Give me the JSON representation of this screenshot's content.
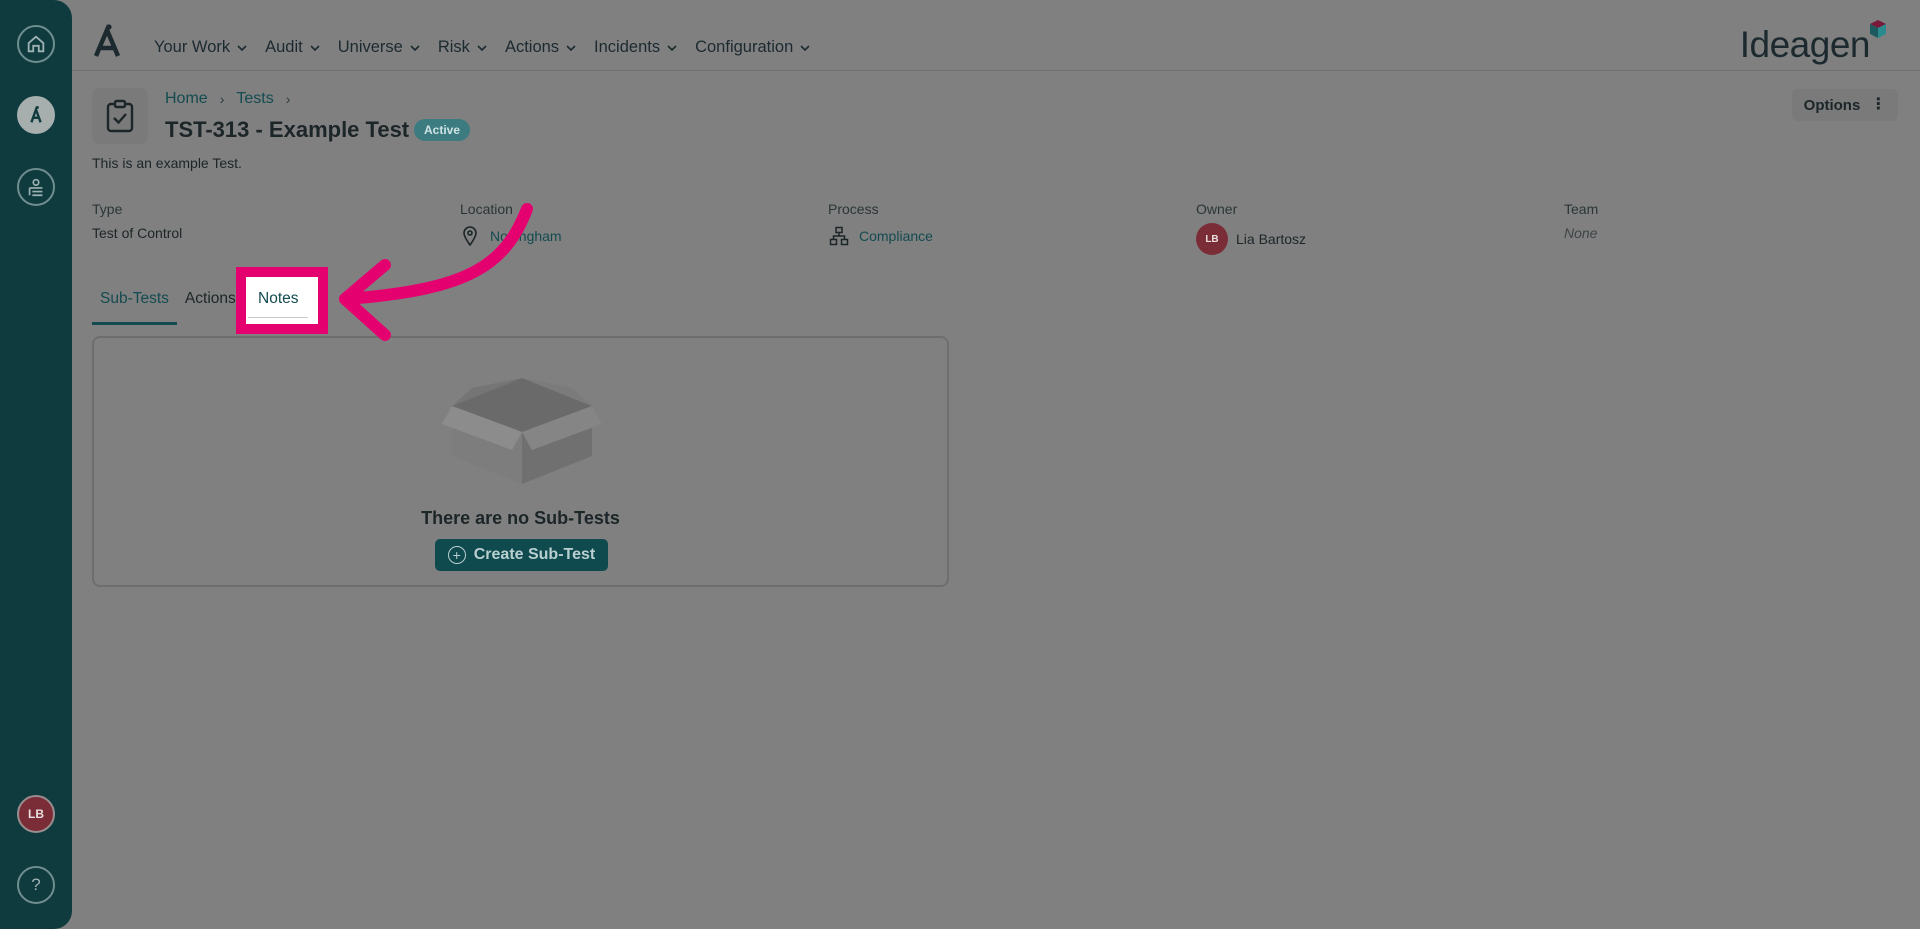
{
  "sidebar": {
    "items": [
      {
        "icon": "home-icon"
      },
      {
        "icon": "ideagen-app-icon"
      },
      {
        "icon": "user-org-icon"
      }
    ],
    "avatar_initials": "LB",
    "help_label": "?"
  },
  "nav": {
    "items": [
      {
        "label": "Your Work"
      },
      {
        "label": "Audit"
      },
      {
        "label": "Universe"
      },
      {
        "label": "Risk"
      },
      {
        "label": "Actions"
      },
      {
        "label": "Incidents"
      },
      {
        "label": "Configuration"
      }
    ],
    "brand": "Ideagen"
  },
  "header": {
    "breadcrumb": [
      "Home",
      "Tests"
    ],
    "title": "TST-313 - Example Test",
    "status": "Active",
    "description": "This is an example Test.",
    "options_label": "Options"
  },
  "fields": {
    "type": {
      "label": "Type",
      "value": "Test of Control"
    },
    "location": {
      "label": "Location",
      "value": "Nottingham"
    },
    "process": {
      "label": "Process",
      "value": "Compliance"
    },
    "owner": {
      "label": "Owner",
      "value": "Lia Bartosz",
      "initials": "LB"
    },
    "team": {
      "label": "Team",
      "value": "None"
    }
  },
  "tabs": [
    {
      "label": "Sub-Tests"
    },
    {
      "label": "Actions"
    },
    {
      "label": "Notes"
    }
  ],
  "panel": {
    "empty_text": "There are no Sub-Tests",
    "create_label": "Create Sub-Test"
  },
  "colors": {
    "rail": "#0f3b3f",
    "accent": "#134b50",
    "highlight": "#e5006f",
    "badge": "#3c7c80"
  }
}
